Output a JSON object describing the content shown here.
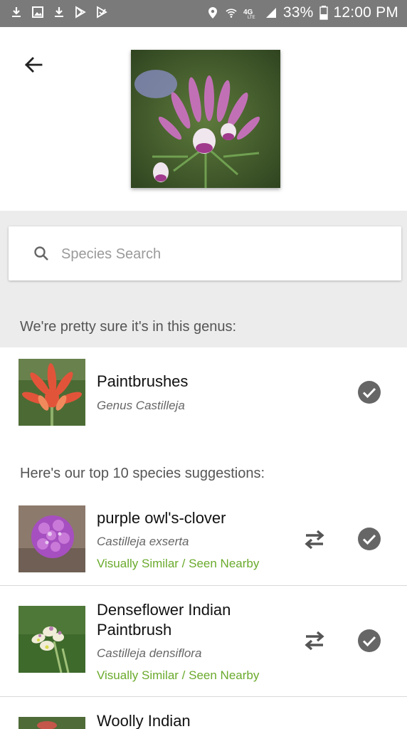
{
  "status_bar": {
    "battery": "33%",
    "time": "12:00 PM",
    "icons": [
      "download-icon",
      "image-icon",
      "download-icon",
      "play-store-icon",
      "play-store-icon",
      "location-icon",
      "wifi-icon",
      "lte-icon",
      "signal-icon",
      "battery-icon"
    ]
  },
  "header": {
    "back_icon": "arrow-left-icon",
    "photo_description": "observation-photo"
  },
  "search": {
    "placeholder": "Species Search",
    "icon": "search-icon"
  },
  "genus_section": {
    "label": "We're pretty sure it's in this genus:",
    "item": {
      "name": "Paintbrushes",
      "scientific": "Genus Castilleja"
    }
  },
  "species_section": {
    "label": "Here's our top 10 species suggestions:",
    "items": [
      {
        "name": "purple owl's-clover",
        "scientific": "Castilleja exserta",
        "tag": "Visually Similar / Seen Nearby"
      },
      {
        "name_line1": "Denseflower Indian",
        "name_line2": "Paintbrush",
        "scientific": "Castilleja densiflora",
        "tag": "Visually Similar / Seen Nearby"
      },
      {
        "name_line1": "Woolly Indian"
      }
    ]
  },
  "colors": {
    "status_bar": "#7a7a7a",
    "accent_green": "#6aaa2c",
    "check_circle": "#666666",
    "section_bg": "#ececec"
  }
}
